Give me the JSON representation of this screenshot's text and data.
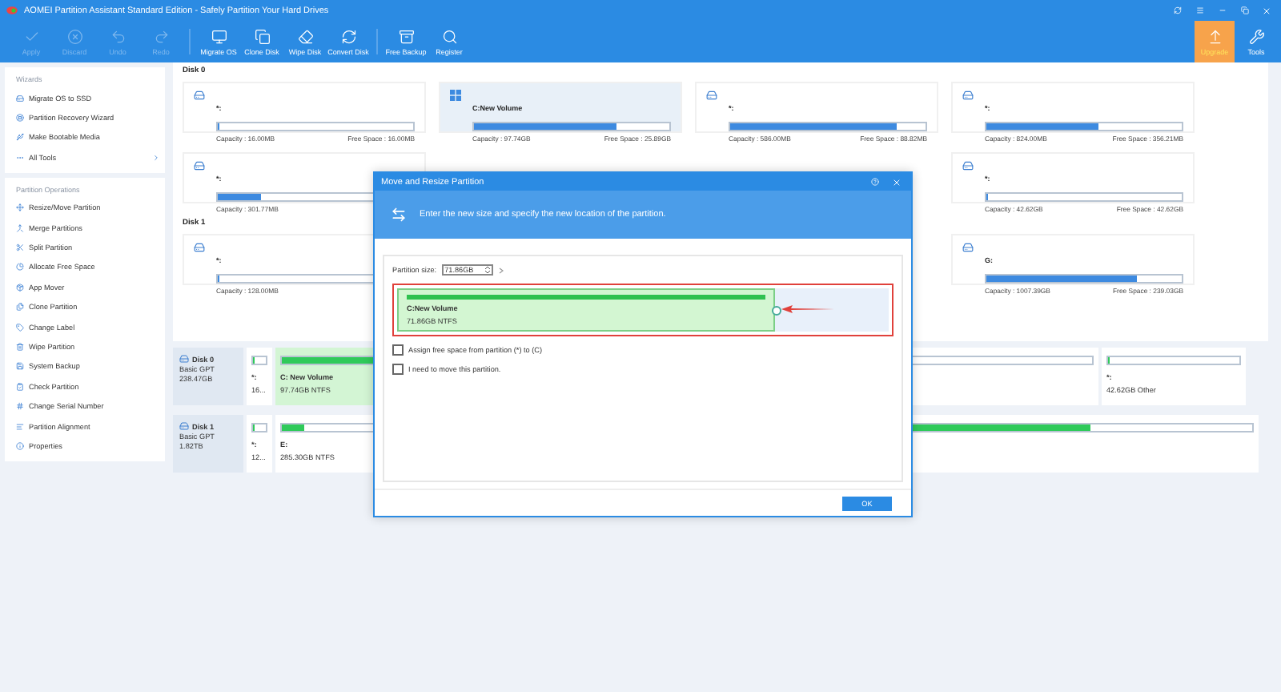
{
  "window": {
    "title": "AOMEI Partition Assistant Standard Edition - Safely Partition Your Hard Drives"
  },
  "toolbar": [
    {
      "label": "Apply",
      "disabled": true
    },
    {
      "label": "Discard",
      "disabled": true
    },
    {
      "label": "Undo",
      "disabled": true
    },
    {
      "label": "Redo",
      "disabled": true
    },
    {
      "label": "Migrate OS",
      "disabled": false
    },
    {
      "label": "Clone Disk",
      "disabled": false
    },
    {
      "label": "Wipe Disk",
      "disabled": false
    },
    {
      "label": "Convert Disk",
      "disabled": false
    },
    {
      "label": "Free Backup",
      "disabled": false
    },
    {
      "label": "Register",
      "disabled": false
    }
  ],
  "upgrade": {
    "label": "Upgrade"
  },
  "tools": {
    "label": "Tools"
  },
  "sidebar": [
    {
      "title": "Wizards",
      "items": [
        {
          "label": "Migrate OS to SSD"
        },
        {
          "label": "Partition Recovery Wizard"
        },
        {
          "label": "Make Bootable Media"
        },
        {
          "label": "All Tools",
          "expandable": true
        }
      ]
    },
    {
      "title": "Partition Operations",
      "items": [
        {
          "label": "Resize/Move Partition"
        },
        {
          "label": "Merge Partitions"
        },
        {
          "label": "Split Partition"
        },
        {
          "label": "Allocate Free Space"
        },
        {
          "label": "App Mover"
        },
        {
          "label": "Clone Partition"
        },
        {
          "label": "Change Label"
        },
        {
          "label": "Wipe Partition"
        },
        {
          "label": "System Backup"
        },
        {
          "label": "Check Partition"
        },
        {
          "label": "Change Serial Number"
        },
        {
          "label": "Partition Alignment"
        },
        {
          "label": "Properties"
        }
      ]
    }
  ],
  "disks": [
    {
      "label": "Disk 0",
      "partitions": [
        {
          "kind": "drive",
          "name": "*:",
          "capacity": "Capacity : 16.00MB",
          "free": "Free Space : 16.00MB",
          "level": 0,
          "selected": false
        },
        {
          "kind": "system",
          "name": "C:New Volume",
          "capacity": "Capacity : 97.74GB",
          "free": "Free Space : 25.89GB",
          "level": 0.73,
          "selected": true
        },
        {
          "kind": "drive",
          "name": "*:",
          "capacity": "Capacity : 586.00MB",
          "free": "Free Space : 88.82MB",
          "level": 0.85,
          "selected": false
        },
        {
          "kind": "drive",
          "name": "*:",
          "capacity": "Capacity : 824.00MB",
          "free": "Free Space : 356.21MB",
          "level": 0.57,
          "selected": false
        },
        {
          "kind": "drive",
          "name": "*:",
          "capacity": "Capacity : 301.77MB",
          "level": 0.22,
          "selected": false
        },
        {
          "kind": "covered"
        },
        {
          "kind": "covered"
        },
        {
          "kind": "drive",
          "name": "*:",
          "capacity": "Capacity : 42.62GB",
          "free": "Free Space : 42.62GB",
          "level": 0,
          "selected": false
        }
      ]
    },
    {
      "label": "Disk 1",
      "partitions": [
        {
          "kind": "drive",
          "name": "*:",
          "capacity": "Capacity : 128.00MB",
          "level": 0,
          "selected": false
        },
        {
          "kind": "covered"
        },
        {
          "kind": "covered"
        },
        {
          "kind": "drive",
          "name": "G:",
          "capacity": "Capacity : 1007.39GB",
          "free": "Free Space : 239.03GB",
          "level": 0.77,
          "selected": false
        }
      ]
    }
  ],
  "disk_map": [
    {
      "name": "Disk 0",
      "type": "Basic GPT",
      "size": "238.47GB",
      "partitions": [
        {
          "name": "*:",
          "info": "16...",
          "level": 0,
          "selected": false
        },
        {
          "name": "C: New Volume",
          "info": "97.74GB NTFS",
          "level": 0.73,
          "selected": true
        },
        {
          "level": 0,
          "selected": false
        },
        {
          "name": "*:",
          "info": "42.62GB Other",
          "level": 0,
          "selected": false
        }
      ]
    },
    {
      "name": "Disk 1",
      "type": "Basic GPT",
      "size": "1.82TB",
      "partitions": [
        {
          "name": "*:",
          "info": "12...",
          "level": 0,
          "selected": false
        },
        {
          "name": "E:",
          "info": "285.30GB NTFS",
          "level": 0.15,
          "selected": false
        },
        {
          "level": 0.8,
          "selected": false
        }
      ]
    }
  ],
  "dialog": {
    "title": "Move and Resize Partition",
    "instruction": "Enter the new size and specify the new location of the partition.",
    "size_label": "Partition size:",
    "size_value": "71.86GB",
    "partition_name": "C:New Volume",
    "partition_info": "71.86GB NTFS",
    "level": 0.77,
    "options": [
      {
        "label": "Assign free space from partition (*) to (C)",
        "checked": false
      },
      {
        "label": "I need to move this partition.",
        "checked": false
      }
    ],
    "ok": "OK"
  }
}
